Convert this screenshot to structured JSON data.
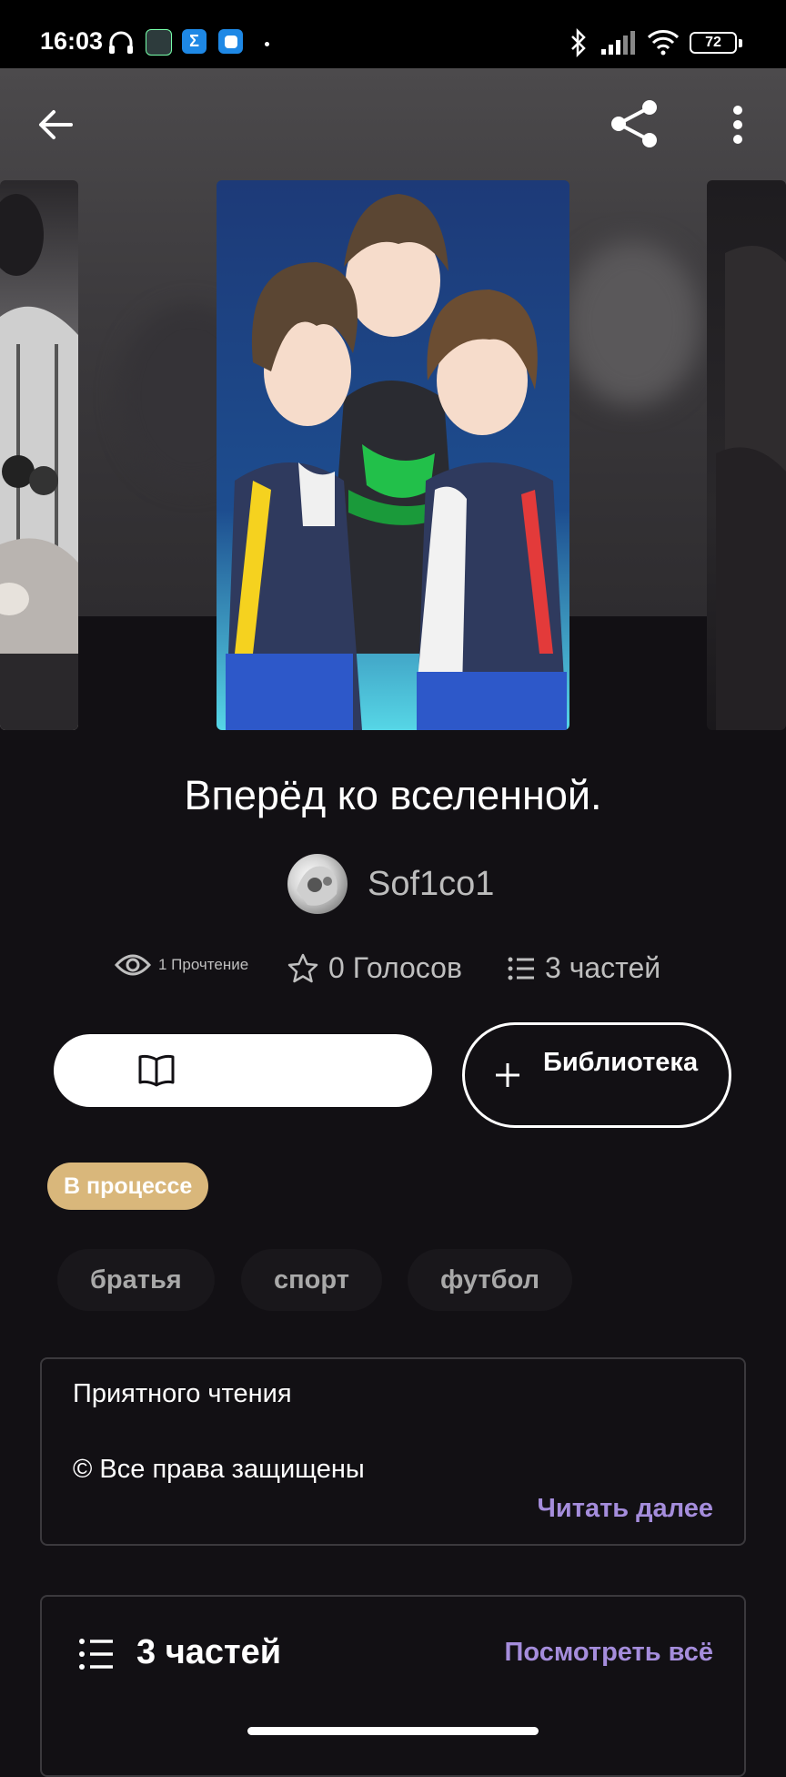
{
  "status_bar": {
    "time": "16:03",
    "battery": "72",
    "icons": [
      "headphones-icon",
      "app-notification-icon",
      "sigma-app-icon",
      "blue-app-icon",
      "dot-icon",
      "bluetooth-icon",
      "signal-icon",
      "wifi-icon",
      "battery-icon"
    ]
  },
  "toolbar": {
    "back_icon": "arrow-left-icon",
    "share_icon": "share-icon",
    "more_icon": "more-vertical-icon"
  },
  "story": {
    "title": "Вперёд ко вселенной.",
    "author": "Sof1co1",
    "reads_label": "1 Прочтение",
    "votes_label": "0 Голосов",
    "parts_label": "3 частей"
  },
  "actions": {
    "read_icon": "open-book-icon",
    "library_icon": "plus-icon",
    "library_label": "Библиотека"
  },
  "status_badge": "В процессе",
  "tags": [
    "братья",
    "спорт",
    "футбол"
  ],
  "description": {
    "line1": "Приятного чтения",
    "line2": "© Все права защищены",
    "read_more": "Читать далее"
  },
  "parts_section": {
    "title": "3 частей",
    "view_all": "Посмотреть всё"
  },
  "colors": {
    "background": "#121014",
    "accent_purple": "#a58ddc",
    "badge_gold": "#d9b77b",
    "border": "#3b393d"
  }
}
